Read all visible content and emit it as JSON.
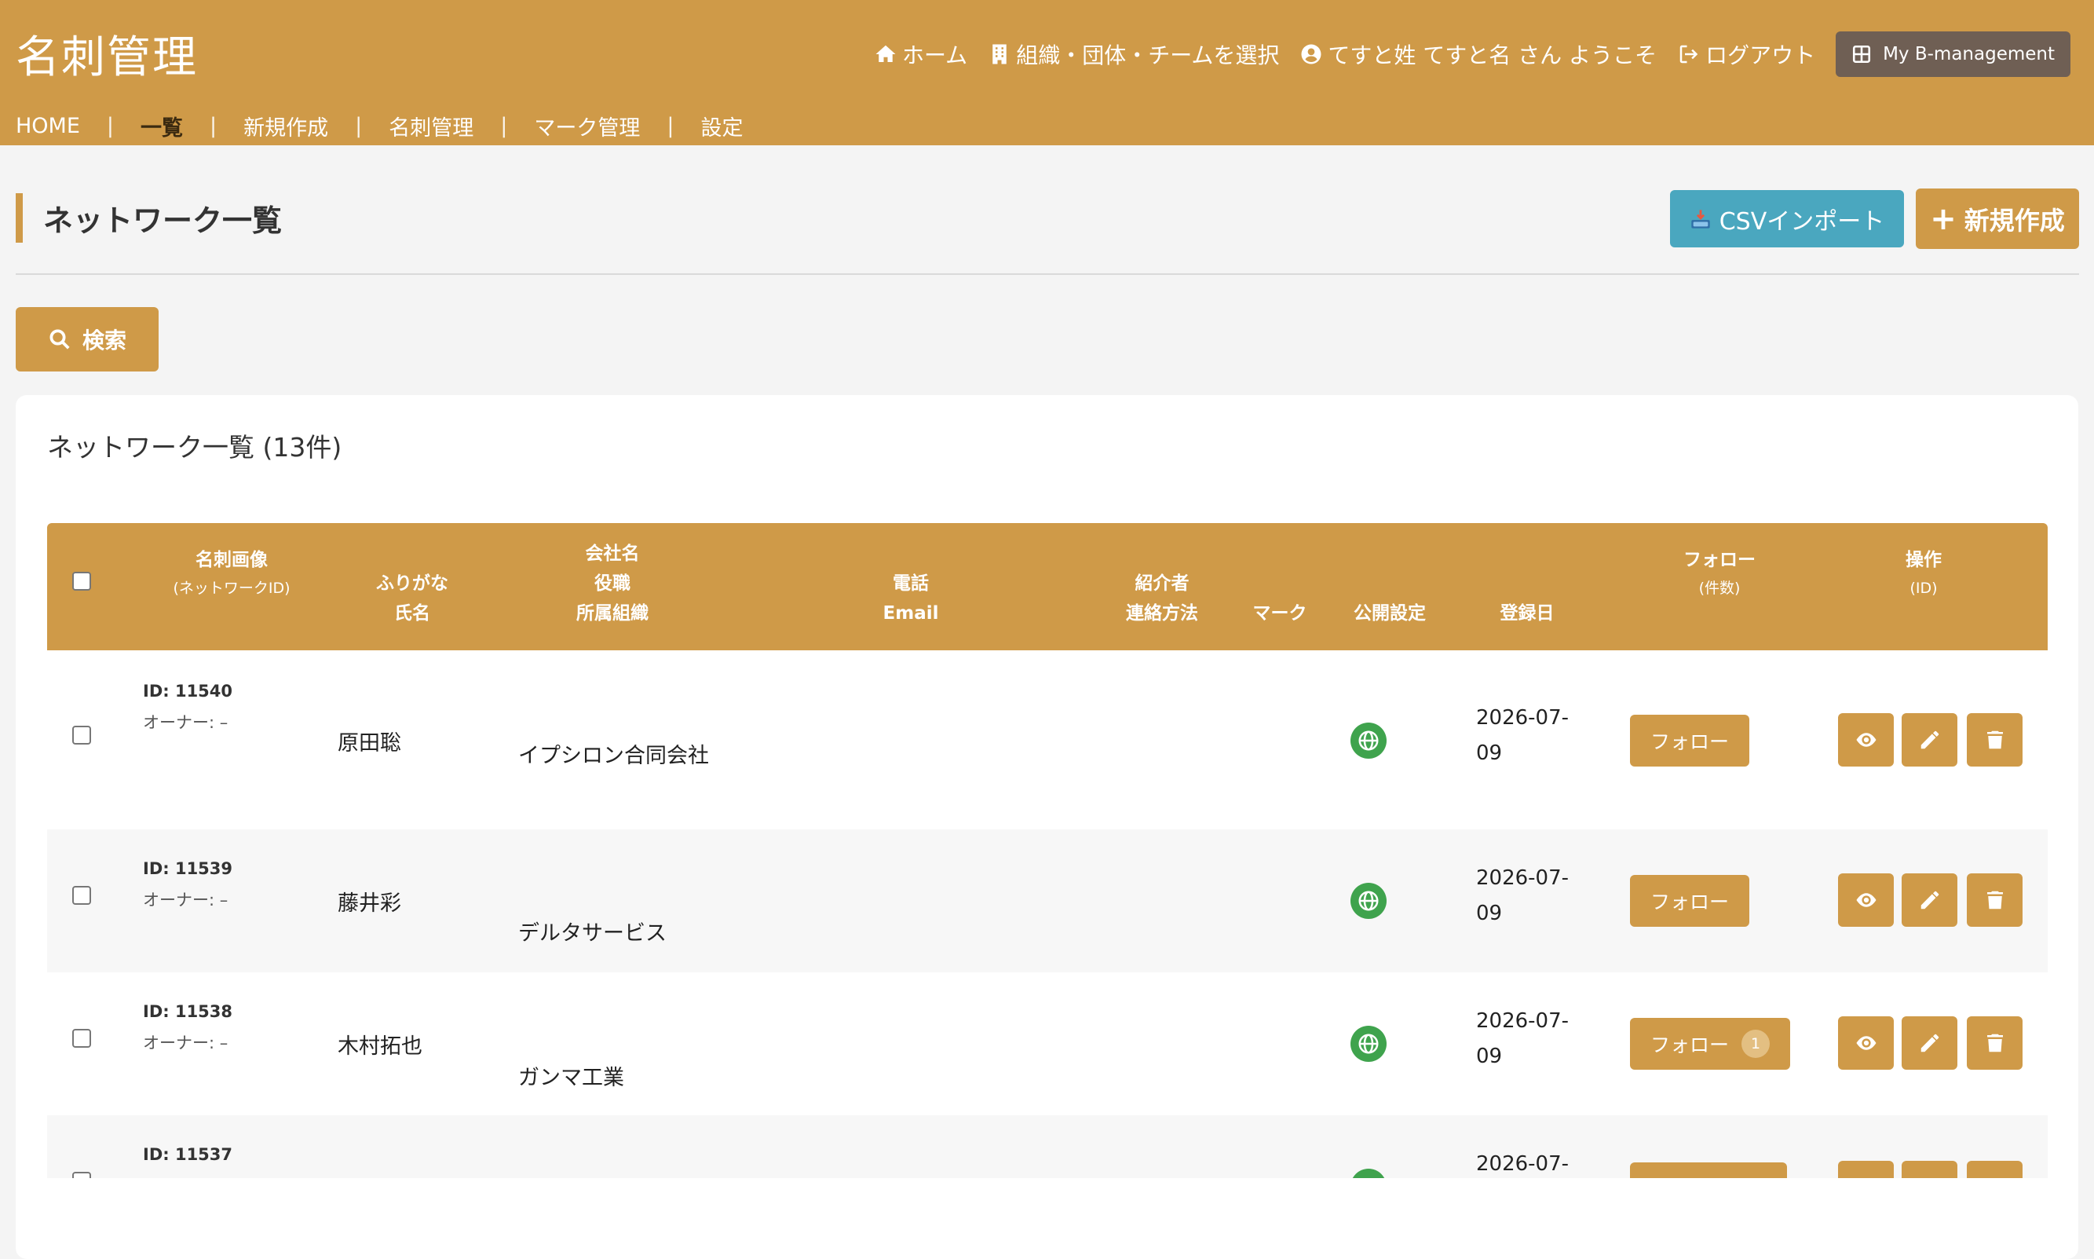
{
  "header": {
    "brand": "名刺管理",
    "nav": {
      "home": "ホーム",
      "select_org": "組織・団体・チームを選択",
      "welcome": "てすと姓 てすと名 さん ようこそ",
      "logout": "ログアウト",
      "my_bm": "My B-management"
    },
    "subnav": [
      "HOME",
      "一覧",
      "新規作成",
      "名刺管理",
      "マーク管理",
      "設定"
    ],
    "subnav_active": "一覧"
  },
  "page": {
    "title": "ネットワーク一覧",
    "csv_import": "CSVインポート",
    "new_button": "新規作成",
    "search_button": "検索"
  },
  "list": {
    "title": "ネットワーク一覧 (13件)",
    "headers": {
      "image": "名刺画像",
      "image_sub": "(ネットワークID)",
      "furigana": "ふりがな",
      "name": "氏名",
      "company": "会社名",
      "position": "役職",
      "org": "所属組織",
      "phone": "電話",
      "email": "Email",
      "referrer": "紹介者",
      "contact": "連絡方法",
      "mark": "マーク",
      "public": "公開設定",
      "reg_date": "登録日",
      "follow": "フォロー",
      "follow_sub": "(件数)",
      "ops": "操作",
      "ops_sub": "(ID)"
    },
    "rows": [
      {
        "id": "ID: 11540",
        "owner": "オーナー: –",
        "name": "原田聡",
        "company": "イプシロン合同会社",
        "date": "2026-07-09",
        "follow": "フォロー",
        "follow_count": ""
      },
      {
        "id": "ID: 11539",
        "owner": "オーナー: –",
        "name": "藤井彩",
        "company": "デルタサービス",
        "date": "2026-07-09",
        "follow": "フォロー",
        "follow_count": ""
      },
      {
        "id": "ID: 11538",
        "owner": "オーナー: –",
        "name": "木村拓也",
        "company": "ガンマ工業",
        "date": "2026-07-09",
        "follow": "フォロー",
        "follow_count": "1"
      },
      {
        "id": "ID: 11537",
        "owner": "",
        "name": "",
        "company": "",
        "date": "2026-07-",
        "follow": "",
        "follow_count": ""
      }
    ]
  },
  "colors": {
    "primary": "#cf9a48",
    "info": "#4aa7bf",
    "dark": "#6f5f54",
    "public_globe": "#3fa34d"
  }
}
